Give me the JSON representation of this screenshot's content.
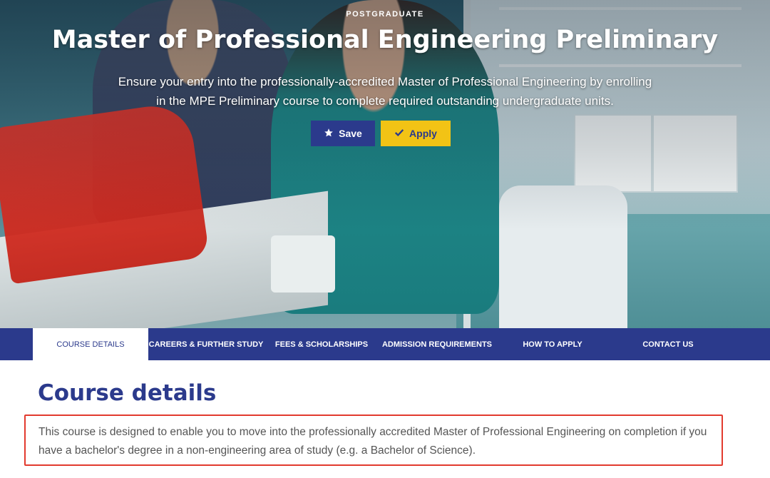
{
  "hero": {
    "eyebrow": "POSTGRADUATE",
    "title": "Master of Professional Engineering Preliminary",
    "subtitle": "Ensure your entry into the professionally-accredited Master of Professional Engineering by enrolling in the MPE Preliminary course to complete required outstanding undergraduate units.",
    "save_label": "Save",
    "apply_label": "Apply",
    "save_icon": "star-icon",
    "apply_icon": "check-icon"
  },
  "nav": {
    "tabs": [
      {
        "label": "COURSE DETAILS",
        "active": true
      },
      {
        "label": "CAREERS & FURTHER STUDY",
        "active": false
      },
      {
        "label": "FEES & SCHOLARSHIPS",
        "active": false
      },
      {
        "label": "ADMISSION REQUIREMENTS",
        "active": false
      },
      {
        "label": "HOW TO APPLY",
        "active": false
      },
      {
        "label": "CONTACT US",
        "active": false
      }
    ]
  },
  "content": {
    "section_title": "Course details",
    "intro": "This course is designed to enable you to move into the professionally accredited Master of Professional Engineering on completion if you have a bachelor's degree in a non-engineering area of study (e.g. a Bachelor of Science)."
  },
  "colors": {
    "brand_blue": "#2b3a8c",
    "accent_yellow": "#f2c315",
    "highlight_red": "#e23a2e"
  }
}
